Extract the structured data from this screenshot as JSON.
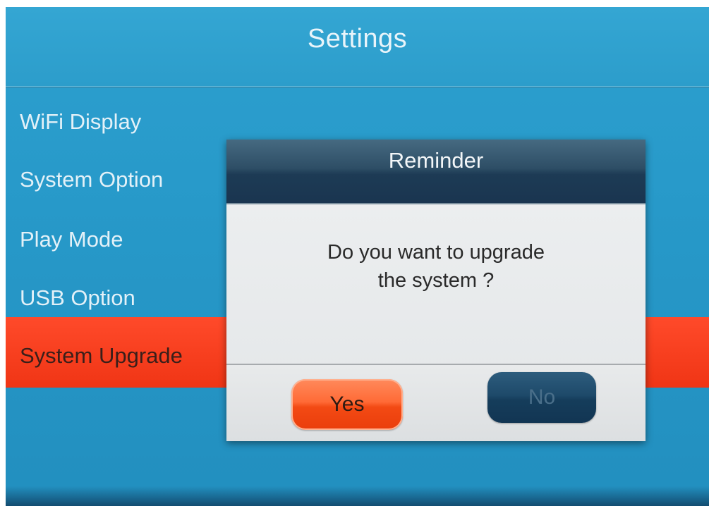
{
  "header": {
    "title": "Settings"
  },
  "menu": {
    "items": [
      {
        "label": "WiFi Display"
      },
      {
        "label": "System Option"
      },
      {
        "label": "Play Mode"
      },
      {
        "label": "USB Option"
      },
      {
        "label": "System Upgrade",
        "selected": true
      }
    ]
  },
  "dialog": {
    "title": "Reminder",
    "message_line1": "Do you want to upgrade",
    "message_line2": "the system ?",
    "yes_label": "Yes",
    "no_label": "No"
  },
  "colors": {
    "background": "#2799c9",
    "selection": "#f03515",
    "dialog_title_bar": "#1d3b55",
    "yes_button": "#f34a14",
    "no_button": "#153d5b"
  }
}
